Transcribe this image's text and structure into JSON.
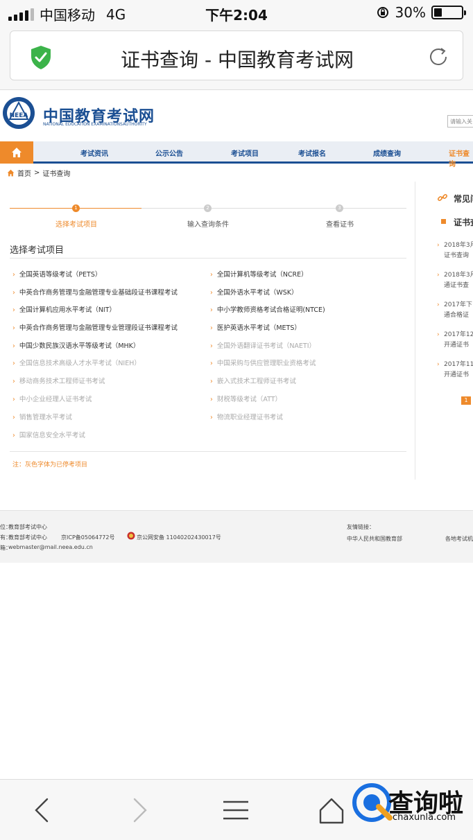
{
  "status": {
    "carrier": "中国移动",
    "network": "4G",
    "time": "下午2:04",
    "battery": "30%",
    "battery_level": 0.3
  },
  "browser": {
    "title": "证书查询 - 中国教育考试网"
  },
  "site": {
    "brand_cn": "中国教育考试网",
    "brand_en": "NATIONAL EDUCATION EXAMINATIONSAUTHORITY",
    "search_placeholder": "请输入关",
    "nav": [
      "考试资讯",
      "公示公告",
      "考试项目",
      "考试报名",
      "成绩查询",
      "证书查询"
    ],
    "breadcrumb": {
      "home": "首页",
      "sep": ">",
      "current": "证书查询"
    },
    "steps": [
      {
        "num": "1",
        "label": "选择考试项目"
      },
      {
        "num": "2",
        "label": "输入查询条件"
      },
      {
        "num": "3",
        "label": "查看证书"
      }
    ],
    "section_title": "选择考试项目",
    "exams_left": [
      {
        "name": "全国英语等级考试（PETS）",
        "active": true
      },
      {
        "name": "中英合作商务管理与金融管理专业基础段证书课程考试",
        "active": true
      },
      {
        "name": "全国计算机应用水平考试（NIT）",
        "active": true
      },
      {
        "name": "中英合作商务管理与金融管理专业管理段证书课程考试",
        "active": true
      },
      {
        "name": "中国少数民族汉语水平等级考试（MHK）",
        "active": true
      },
      {
        "name": "全国信息技术高级人才水平考试（NIEH）",
        "active": false
      },
      {
        "name": "移动商务技术工程师证书考试",
        "active": false
      },
      {
        "name": "中小企业经理人证书考试",
        "active": false
      },
      {
        "name": "销售管理水平考试",
        "active": false
      },
      {
        "name": "国家信息安全水平考试",
        "active": false
      }
    ],
    "exams_right": [
      {
        "name": "全国计算机等级考试（NCRE）",
        "active": true
      },
      {
        "name": "全国外语水平考试（WSK）",
        "active": true
      },
      {
        "name": "中小学教师资格考试合格证明(NTCE)",
        "active": true
      },
      {
        "name": "医护英语水平考试（METS）",
        "active": true
      },
      {
        "name": "全国外语翻译证书考试（NAETI）",
        "active": false
      },
      {
        "name": "中国采购与供应管理职业资格考试",
        "active": false
      },
      {
        "name": "嵌入式技术工程师证书考试",
        "active": false
      },
      {
        "name": "财税等级考试（ATT）",
        "active": false
      },
      {
        "name": "物流职业经理证书考试",
        "active": false
      }
    ],
    "note": "注：灰色字体为已停考项目",
    "sidebar": {
      "title": "常见问",
      "subtitle": "证书查",
      "items": [
        [
          "2018年3月",
          "证书查询"
        ],
        [
          "2018年3月",
          "通证书查"
        ],
        [
          "2017年下",
          "通合格证"
        ],
        [
          "2017年12",
          "开通证书"
        ],
        [
          "2017年11",
          "开通证书"
        ]
      ],
      "page": "1"
    },
    "footer": {
      "host_label": "位：",
      "host": "教育部考试中心",
      "sponsor_label": "有：",
      "sponsor": "教育部考试中心",
      "icp": "京ICP备05064772号",
      "police": "京公网安备 11040202430017号",
      "email_label": "箱：",
      "email": "webmaster@mail.neea.edu.cn",
      "links_label": "友情链接：",
      "link1": "中华人民共和国教育部",
      "link2": "各地考试机"
    }
  },
  "watermark": {
    "text": "查询啦",
    "url": "chaxunla.com"
  }
}
